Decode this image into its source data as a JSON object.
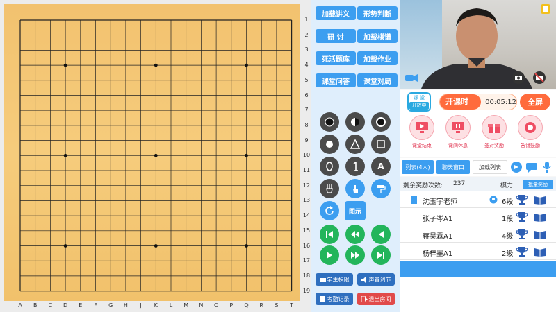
{
  "board": {
    "columns": [
      "A",
      "B",
      "C",
      "D",
      "E",
      "F",
      "G",
      "H",
      "J",
      "K",
      "L",
      "M",
      "N",
      "O",
      "P",
      "Q",
      "R",
      "S",
      "T"
    ],
    "rows": [
      "1",
      "2",
      "3",
      "4",
      "5",
      "6",
      "7",
      "8",
      "9",
      "10",
      "11",
      "12",
      "13",
      "14",
      "15",
      "16",
      "17",
      "18",
      "19"
    ]
  },
  "tools": {
    "top_buttons": [
      "加载讲义",
      "形势判断",
      "研 讨",
      "加载棋谱",
      "死活题库",
      "加载作业",
      "课堂问答",
      "课堂对局"
    ],
    "letter_a": "A",
    "show_label": "图示",
    "bottom_buttons": [
      "学生权限",
      "声音调节",
      "考勤记录",
      "退出房间"
    ]
  },
  "classroom": {
    "badge_top": "课 堂",
    "badge_bottom": "开放中",
    "timer_label": "开课时长",
    "timer_value": "00:05:12",
    "fullscreen_label": "全屏",
    "actions": [
      "课堂结束",
      "课间休息",
      "签对奖励",
      "答错鼓励"
    ]
  },
  "tabs": {
    "list": "列表(4人)",
    "chat": "聊天窗口",
    "load_list": "加载列表"
  },
  "reward": {
    "label": "剩余奖励次数:",
    "count": "237",
    "skill_label": "棋力",
    "batch_label": "批量奖励"
  },
  "students": [
    {
      "name": "沈玉宇老师",
      "rank": "6段"
    },
    {
      "name": "张子岑A1",
      "rank": "1段"
    },
    {
      "name": "蒋昊霖A1",
      "rank": "4级"
    },
    {
      "name": "杨梓墨A1",
      "rank": "2级"
    }
  ],
  "colors": {
    "accent": "#3c9ef0",
    "board": "#f4c675",
    "green": "#23b55b",
    "orange": "#ff6b3d"
  }
}
